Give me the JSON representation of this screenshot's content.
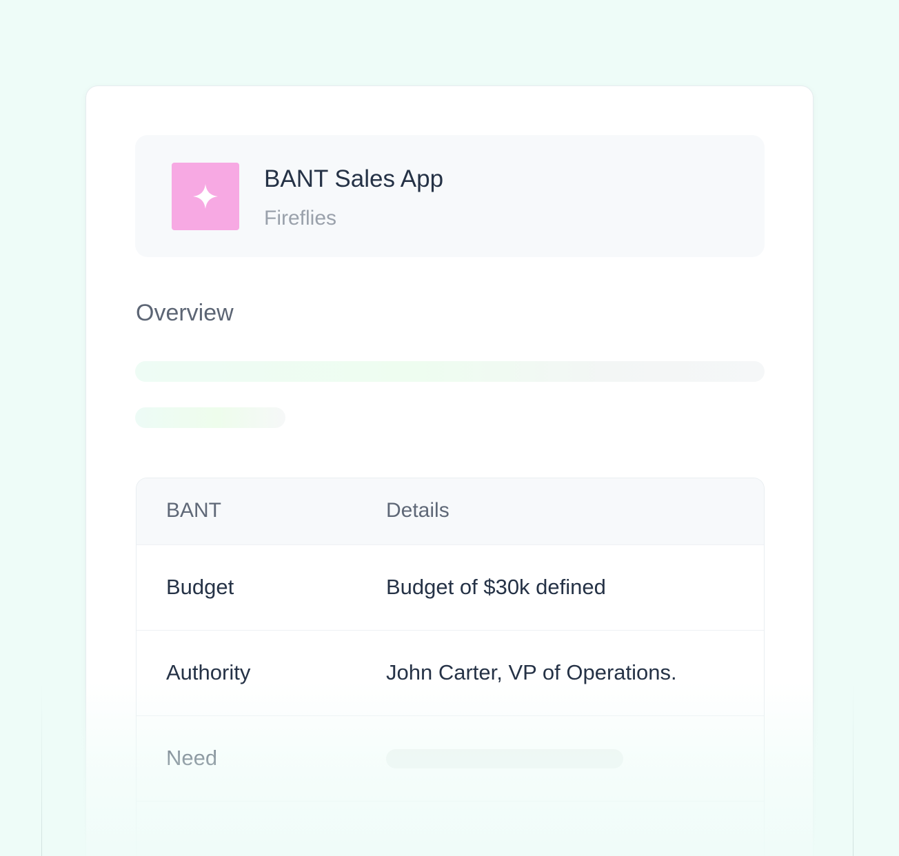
{
  "app": {
    "title": "BANT Sales App",
    "subtitle": "Fireflies",
    "icon": "sparkle-icon",
    "icon_color": "#f7a9e3"
  },
  "overview": {
    "title": "Overview"
  },
  "table": {
    "headers": [
      "BANT",
      "Details"
    ],
    "rows": [
      {
        "label": "Budget",
        "detail": "Budget of $30k defined"
      },
      {
        "label": "Authority",
        "detail": "John Carter, VP of Operations."
      },
      {
        "label": "Need",
        "detail": ""
      }
    ]
  },
  "colors": {
    "background": "#eefcf8",
    "text_primary": "#253246",
    "text_muted": "#9aa1ab"
  }
}
